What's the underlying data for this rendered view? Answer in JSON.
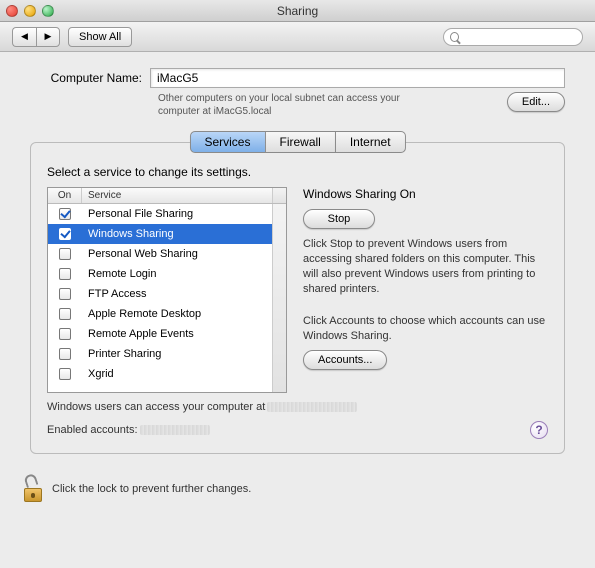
{
  "window": {
    "title": "Sharing"
  },
  "toolbar": {
    "show_all": "Show All",
    "search_placeholder": ""
  },
  "computer_name": {
    "label": "Computer Name:",
    "value": "iMacG5",
    "note": "Other computers on your local subnet can access your computer at iMacG5.local",
    "edit": "Edit..."
  },
  "tabs": [
    {
      "label": "Services",
      "active": true
    },
    {
      "label": "Firewall",
      "active": false
    },
    {
      "label": "Internet",
      "active": false
    }
  ],
  "panel": {
    "instruction": "Select a service to change its settings.",
    "columns": {
      "on": "On",
      "service": "Service"
    },
    "services": [
      {
        "name": "Personal File Sharing",
        "on": true,
        "selected": false
      },
      {
        "name": "Windows Sharing",
        "on": true,
        "selected": true
      },
      {
        "name": "Personal Web Sharing",
        "on": false,
        "selected": false
      },
      {
        "name": "Remote Login",
        "on": false,
        "selected": false
      },
      {
        "name": "FTP Access",
        "on": false,
        "selected": false
      },
      {
        "name": "Apple Remote Desktop",
        "on": false,
        "selected": false
      },
      {
        "name": "Remote Apple Events",
        "on": false,
        "selected": false
      },
      {
        "name": "Printer Sharing",
        "on": false,
        "selected": false
      },
      {
        "name": "Xgrid",
        "on": false,
        "selected": false
      }
    ],
    "detail": {
      "title": "Windows Sharing On",
      "stop": "Stop",
      "stop_desc": "Click Stop to prevent Windows users from accessing shared folders on this computer. This will also prevent Windows users from printing to shared printers.",
      "accounts_desc": "Click Accounts to choose which accounts can use Windows Sharing.",
      "accounts": "Accounts..."
    },
    "footer1": "Windows users can access your computer at",
    "footer2": "Enabled accounts:",
    "help": "?"
  },
  "lock": {
    "text": "Click the lock to prevent further changes."
  }
}
